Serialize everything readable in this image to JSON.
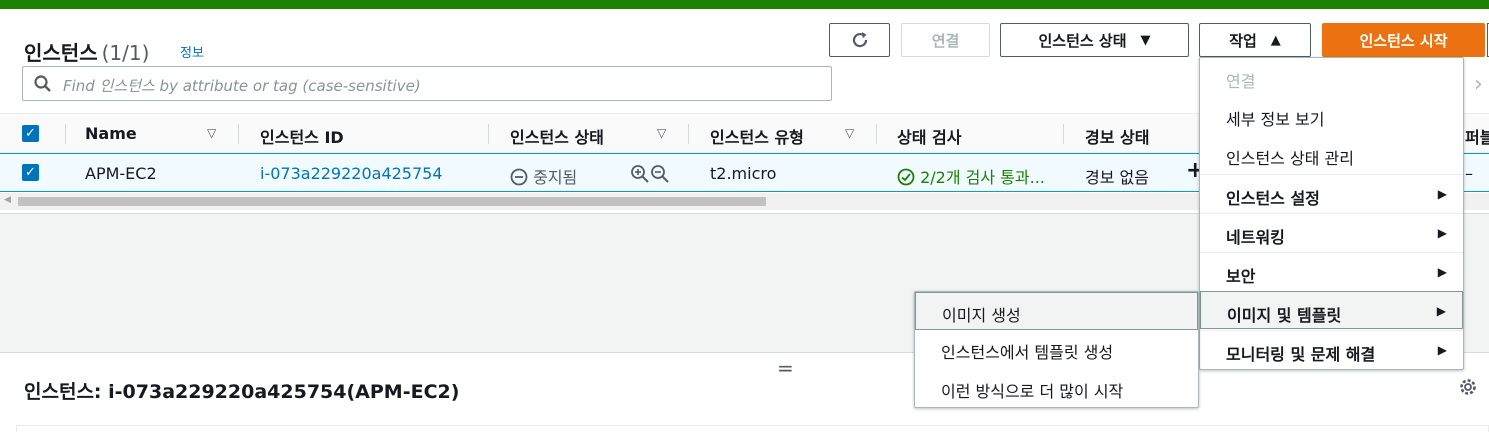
{
  "header": {
    "title": "인스턴스",
    "count": "(1/1)",
    "info_link": "정보"
  },
  "toolbar": {
    "connect": "연결",
    "instance_state": "인스턴스 상태",
    "actions": "작업",
    "launch": "인스턴스 시작"
  },
  "search": {
    "placeholder": "Find 인스턴스 by attribute or tag (case-sensitive)"
  },
  "table": {
    "columns": [
      "Name",
      "인스턴스 ID",
      "인스턴스 상태",
      "인스턴스 유형",
      "상태 검사",
      "경보 상태",
      "퍼블"
    ],
    "row": {
      "name": "APM-EC2",
      "instance_id": "i-073a229220a425754",
      "state": "중지됨",
      "type": "t2.micro",
      "status_check": "2/2개 검사 통과...",
      "alarm": "경보 없음",
      "public": "–"
    }
  },
  "actions_menu": {
    "items": [
      {
        "label": "연결"
      },
      {
        "label": "세부 정보 보기"
      },
      {
        "label": "인스턴스 상태 관리"
      },
      {
        "label": "인스턴스 설정"
      },
      {
        "label": "네트워킹"
      },
      {
        "label": "보안"
      },
      {
        "label": "이미지 및 템플릿"
      },
      {
        "label": "모니터링 및 문제 해결"
      }
    ]
  },
  "submenu": {
    "items": [
      {
        "label": "이미지 생성"
      },
      {
        "label": "인스턴스에서 템플릿 생성"
      },
      {
        "label": "이런 방식으로 더 많이 시작"
      }
    ]
  },
  "detail": {
    "title": "인스턴스: i-073a229220a425754(APM-EC2)"
  },
  "colors": {
    "accent": "#ec7211",
    "link": "#0073bb",
    "success": "#1d8102"
  }
}
